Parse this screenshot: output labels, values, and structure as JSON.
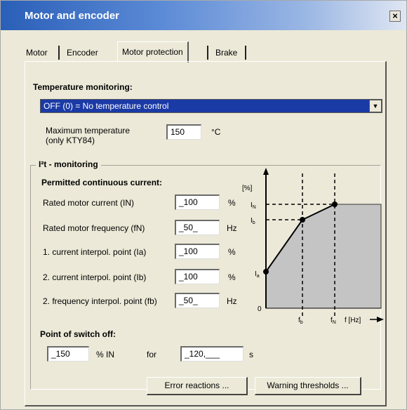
{
  "window": {
    "title": "Motor and encoder",
    "close_symbol": "×"
  },
  "tabs": [
    {
      "label": "Motor"
    },
    {
      "label": "Encoder"
    },
    {
      "label": "Motor protection",
      "active": true
    },
    {
      "label": "Brake"
    }
  ],
  "temperature": {
    "title": "Temperature monitoring:",
    "select_value": "OFF (0) = No temperature control",
    "dropdown_icon": "chevron-down",
    "max_temp_label_1": "Maximum temperature",
    "max_temp_label_2": "(only KTY84)",
    "max_temp_value": "150",
    "max_temp_unit": "°C"
  },
  "i2t": {
    "title": "I²t - monitoring",
    "permitted_title": "Permitted continuous current:",
    "fields": [
      {
        "label": "Rated motor current (IN)",
        "value": "_100",
        "unit": "%"
      },
      {
        "label": "Rated motor frequency (fN)",
        "value": "_50_",
        "unit": "Hz"
      },
      {
        "label": "1. current interpol. point (Ia)",
        "value": "_100",
        "unit": "%"
      },
      {
        "label": "2. current interpol. point (Ib)",
        "value": "_100",
        "unit": "%"
      },
      {
        "label": "2. frequency interpol. point (fb)",
        "value": "_50_",
        "unit": "Hz"
      }
    ]
  },
  "graph": {
    "y_unit": "[%]",
    "y_labels": {
      "iN": "I",
      "iN_sub": "N",
      "ib": "I",
      "ib_sub": "b",
      "ia": "I",
      "ia_sub": "a",
      "zero": "0"
    },
    "x_labels": {
      "fb": "f",
      "fb_sub": "b",
      "fN": "f",
      "fN_sub": "N",
      "axis": "f [Hz]"
    }
  },
  "switch_off": {
    "title": "Point of switch off:",
    "current_value": "_150",
    "current_unit": "% IN",
    "for_label": "for",
    "time_value": "_120,___",
    "time_unit": "s"
  },
  "buttons": {
    "error_reactions": "Error reactions ...",
    "warning_thresholds": "Warning thresholds ..."
  }
}
